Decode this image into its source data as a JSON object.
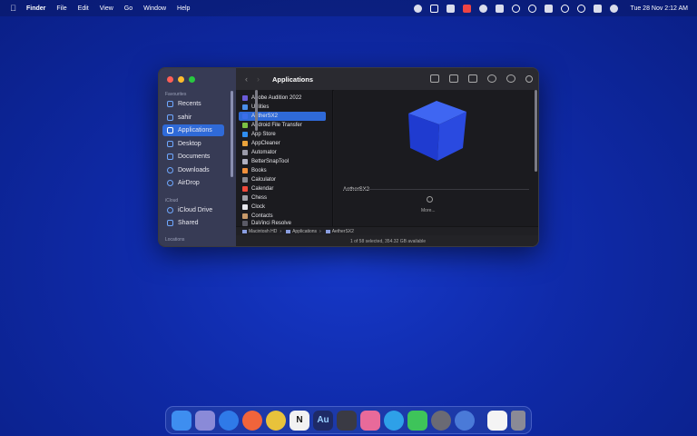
{
  "menubar": {
    "app": "Finder",
    "items": [
      "File",
      "Edit",
      "View",
      "Go",
      "Window",
      "Help"
    ],
    "clock": "Tue 28 Nov  2:12 AM"
  },
  "window": {
    "title": "Applications",
    "sidebar": {
      "favourites_label": "Favourites",
      "icloud_label": "iCloud",
      "locations_label": "Locations",
      "items": [
        "Recents",
        "sahir",
        "Applications",
        "Desktop",
        "Documents",
        "Downloads",
        "AirDrop"
      ],
      "icloud_items": [
        "iCloud Drive",
        "Shared"
      ]
    },
    "files": [
      {
        "name": "Adobe Audition 2022",
        "color": "#6a5bd8"
      },
      {
        "name": "Utilities",
        "color": "#4a8ee8"
      },
      {
        "name": "AetherSX2",
        "color": "#3b6ee8"
      },
      {
        "name": "Android File Transfer",
        "color": "#7bc043"
      },
      {
        "name": "App Store",
        "color": "#2f8ef0"
      },
      {
        "name": "AppCleaner",
        "color": "#e8a23b"
      },
      {
        "name": "Automator",
        "color": "#9a9aa8"
      },
      {
        "name": "BetterSnapTool",
        "color": "#b0b0c0"
      },
      {
        "name": "Books",
        "color": "#f0903b"
      },
      {
        "name": "Calculator",
        "color": "#888890"
      },
      {
        "name": "Calendar",
        "color": "#f04a3b"
      },
      {
        "name": "Chess",
        "color": "#a0a0a8"
      },
      {
        "name": "Clock",
        "color": "#e8e8ee"
      },
      {
        "name": "Contacts",
        "color": "#c89a6a"
      },
      {
        "name": "DaVinci Resolve",
        "color": "#5a5a66"
      }
    ],
    "preview": {
      "name": "AetherSX2",
      "more": "More..."
    },
    "path": [
      "Macintosh HD",
      "Applications",
      "AetherSX2"
    ],
    "status": "1 of 58 selected, 354.32 GB available"
  },
  "dock": {
    "apps": [
      {
        "name": "Finder",
        "color": "#3e8ef0"
      },
      {
        "name": "Launchpad",
        "color": "#8a8ad8"
      },
      {
        "name": "Safari",
        "color": "#2f7ae8"
      },
      {
        "name": "Firefox",
        "color": "#f0643b"
      },
      {
        "name": "Chrome",
        "color": "#e8c23b"
      },
      {
        "name": "Notion",
        "color": "#f2f2f2"
      },
      {
        "name": "Audition",
        "color": "#1e2a66"
      },
      {
        "name": "DaVinci Resolve",
        "color": "#3a3a44"
      },
      {
        "name": "Photos",
        "color": "#e86a9a"
      },
      {
        "name": "Telegram",
        "color": "#2ea0e8"
      },
      {
        "name": "FaceTime",
        "color": "#3ec45a"
      },
      {
        "name": "Disk Utility",
        "color": "#6a6a74"
      },
      {
        "name": "Preview",
        "color": "#4a7ad8"
      }
    ],
    "notion_letter": "N",
    "audition_text": "Au"
  }
}
